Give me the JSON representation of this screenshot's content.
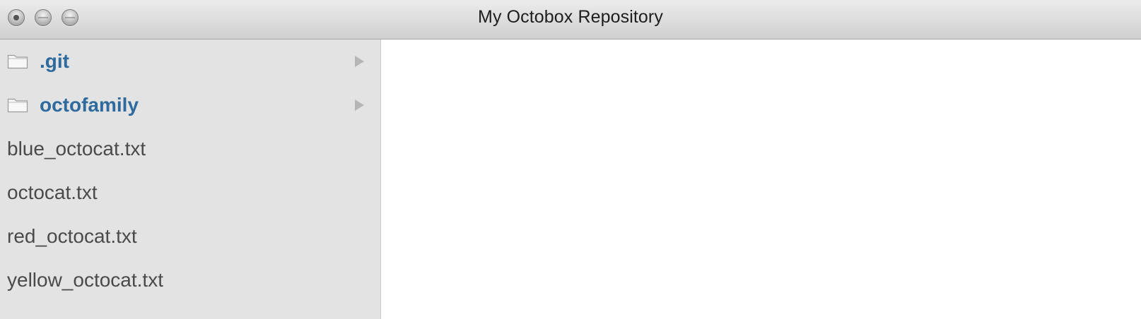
{
  "window": {
    "title": "My Octobox Repository"
  },
  "sidebar": {
    "folders": [
      {
        "name": ".git",
        "icon": "folder-icon"
      },
      {
        "name": "octofamily",
        "icon": "folder-icon"
      }
    ],
    "files": [
      {
        "name": "blue_octocat.txt"
      },
      {
        "name": "octocat.txt"
      },
      {
        "name": "red_octocat.txt"
      },
      {
        "name": "yellow_octocat.txt"
      }
    ]
  },
  "colors": {
    "folder_text": "#2f6a9e",
    "file_text": "#4a4a4a",
    "sidebar_bg": "#e3e3e3"
  }
}
